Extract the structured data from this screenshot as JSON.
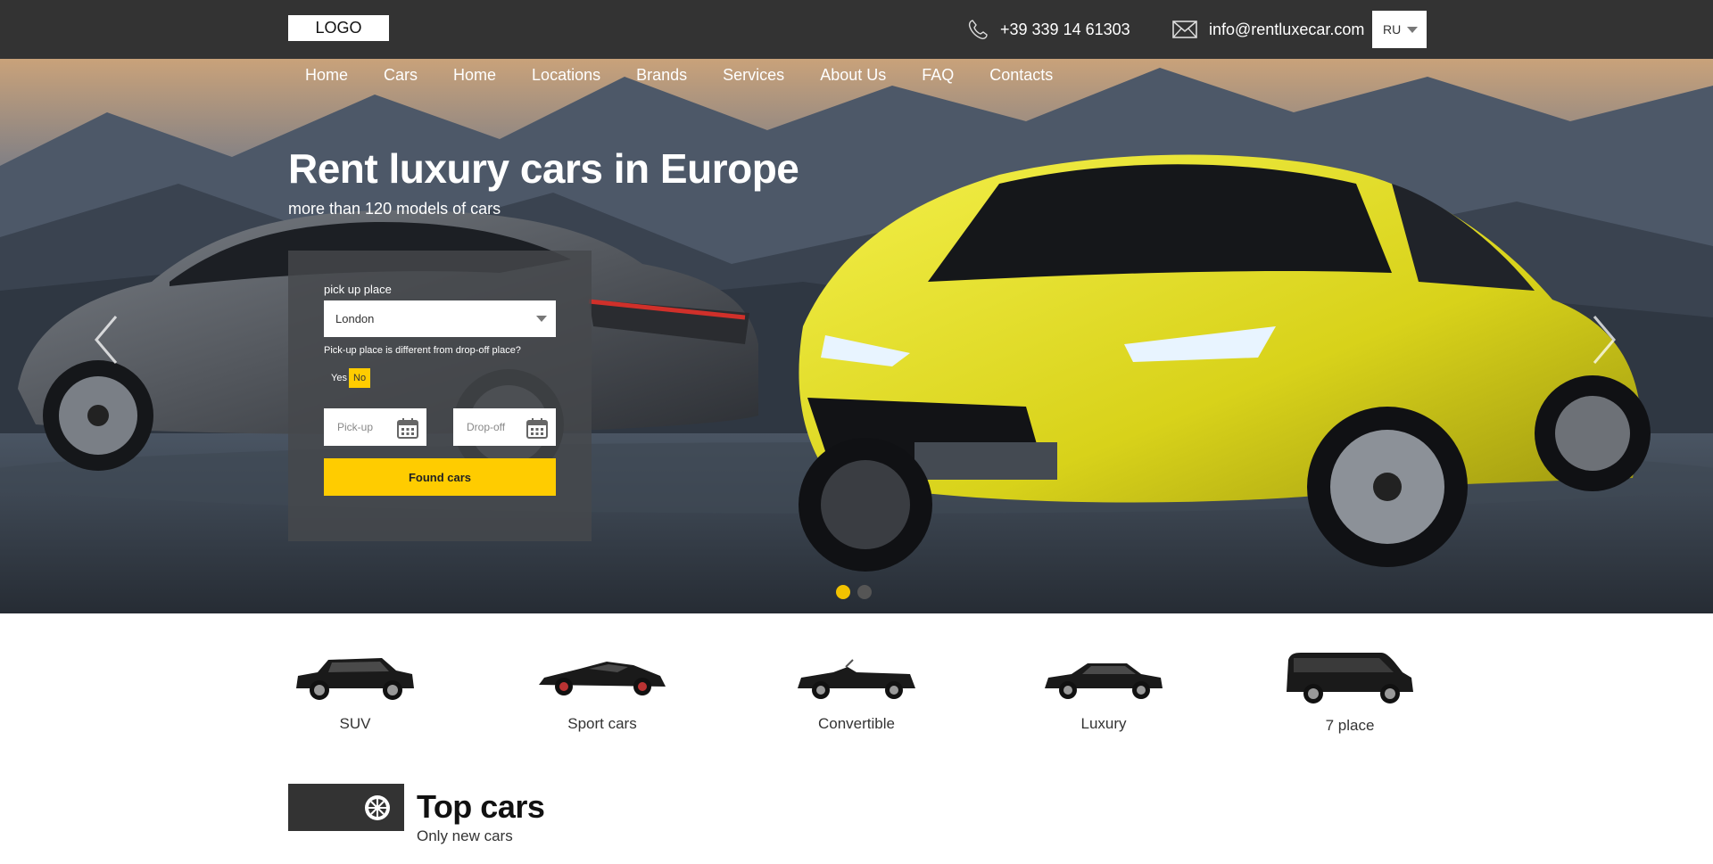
{
  "header": {
    "logo": "LOGO",
    "phone": "+39 339 14 61303",
    "email": "info@rentluxecar.com",
    "language": "RU",
    "icons": [
      "phone-icon",
      "mail-icon",
      "chevron-down-icon"
    ]
  },
  "nav": {
    "items": [
      "Home",
      "Cars",
      "Home",
      "Locations",
      "Brands",
      "Services",
      "About Us",
      "FAQ",
      "Contacts"
    ]
  },
  "hero": {
    "title": "Rent luxury cars in Europe",
    "subtitle": "more than 120 models of cars",
    "slides_total": 2,
    "active_slide": 1
  },
  "search": {
    "pickup_label": "pick up place",
    "pickup_value": "London",
    "question": "Pick-up place is different from drop-off place?",
    "yes_label": "Yes",
    "no_label": "No",
    "selected": "No",
    "pickup_date_placeholder": "Pick-up",
    "dropoff_date_placeholder": "Drop-off",
    "submit_label": "Found cars"
  },
  "categories": [
    {
      "label": "SUV",
      "icon": "suv-car-icon"
    },
    {
      "label": "Sport cars",
      "icon": "sport-car-icon"
    },
    {
      "label": "Convertible",
      "icon": "convertible-car-icon"
    },
    {
      "label": "Luxury",
      "icon": "luxury-car-icon"
    },
    {
      "label": "7 place",
      "icon": "minivan-icon"
    }
  ],
  "top_cars": {
    "title": "Top cars",
    "subtitle": "Only new cars",
    "icon": "wheel-icon"
  },
  "colors": {
    "topbar": "#333333",
    "accent": "#ffcc00",
    "panel": "#46484c"
  }
}
